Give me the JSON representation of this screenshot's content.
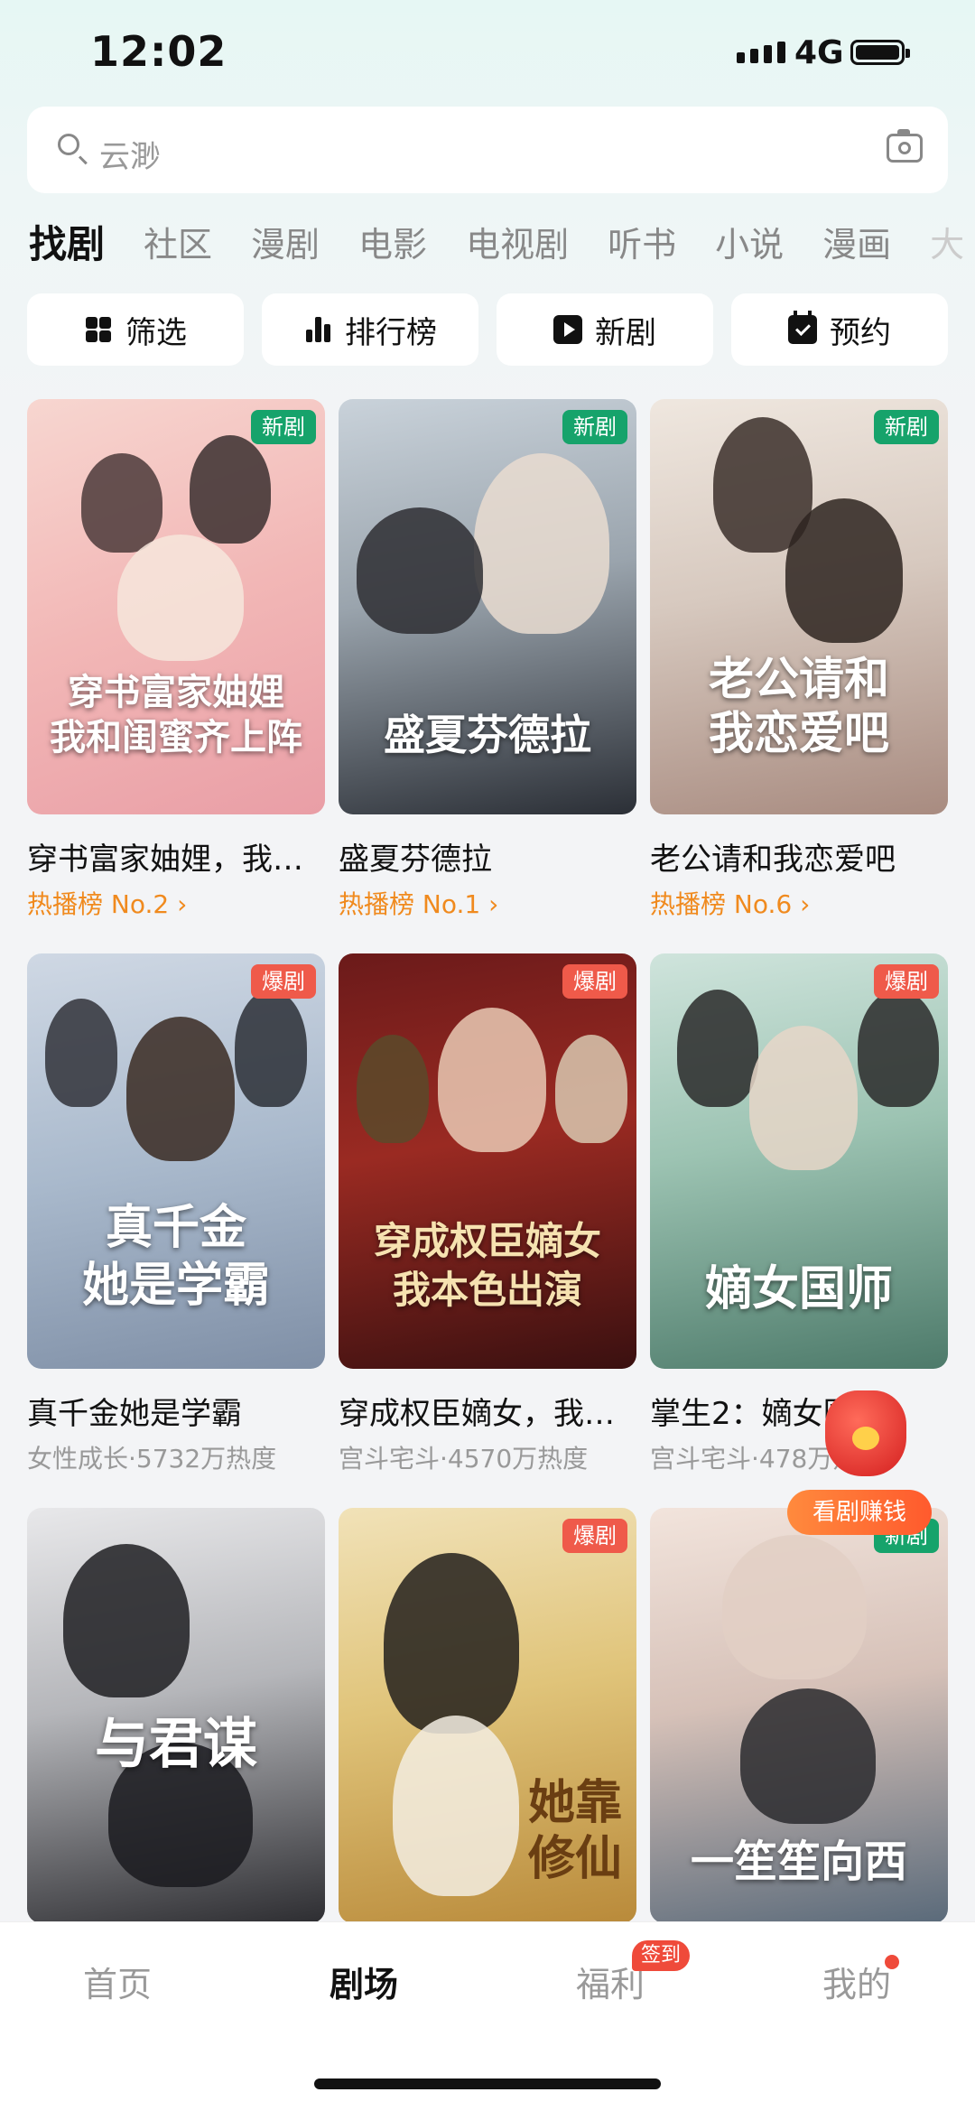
{
  "status": {
    "time": "12:02",
    "network": "4G"
  },
  "search": {
    "placeholder": "云渺"
  },
  "tabs": [
    "找剧",
    "社区",
    "漫剧",
    "电影",
    "电视剧",
    "听书",
    "小说",
    "漫画",
    "大"
  ],
  "quick": [
    {
      "label": "筛选",
      "icon": "filter-icon"
    },
    {
      "label": "排行榜",
      "icon": "ranking-icon"
    },
    {
      "label": "新剧",
      "icon": "play-icon"
    },
    {
      "label": "预约",
      "icon": "calendar-check-icon"
    }
  ],
  "cards": [
    {
      "title": "穿书富家妯娌，我和闺蜜齐上阵",
      "poster_title": "穿书富家妯娌\n我和闺蜜齐上阵",
      "badge": "新剧",
      "sub": "热播榜 No.2 ›",
      "subtype": "rank"
    },
    {
      "title": "盛夏芬德拉",
      "poster_title": "盛夏芬德拉",
      "badge": "新剧",
      "sub": "热播榜 No.1 ›",
      "subtype": "rank"
    },
    {
      "title": "老公请和我恋爱吧",
      "poster_title": "老公请和\n我恋爱吧",
      "badge": "新剧",
      "sub": "热播榜 No.6 ›",
      "subtype": "rank"
    },
    {
      "title": "真千金她是学霸",
      "poster_title": "真千金\n她是学霸",
      "badge": "爆剧",
      "sub": "女性成长·5732万热度",
      "subtype": "tag"
    },
    {
      "title": "穿成权臣嫡女，我本色出演",
      "poster_title": "穿成权臣嫡女\n我本色出演",
      "badge": "爆剧",
      "sub": "宫斗宅斗·4570万热度",
      "subtype": "tag"
    },
    {
      "title": "掌生2：嫡女国师",
      "poster_title": "嫡女国师",
      "badge": "爆剧",
      "sub": "宫斗宅斗·478万热度",
      "subtype": "tag"
    },
    {
      "title": "与君谋",
      "poster_title": "与君谋",
      "badge": "",
      "sub": "",
      "subtype": "tag"
    },
    {
      "title": "她靠修仙在现代风生水起",
      "poster_title": "她靠修仙",
      "badge": "爆剧",
      "sub": "",
      "subtype": "tag"
    },
    {
      "title": "一笙笙向西",
      "poster_title": "一笙笙向西",
      "badge": "新剧",
      "sub": "",
      "subtype": "tag"
    }
  ],
  "promo": {
    "label": "看剧赚钱"
  },
  "nav": {
    "home": "首页",
    "theater": "剧场",
    "welfare": "福利",
    "welfare_badge": "签到",
    "mine": "我的"
  }
}
